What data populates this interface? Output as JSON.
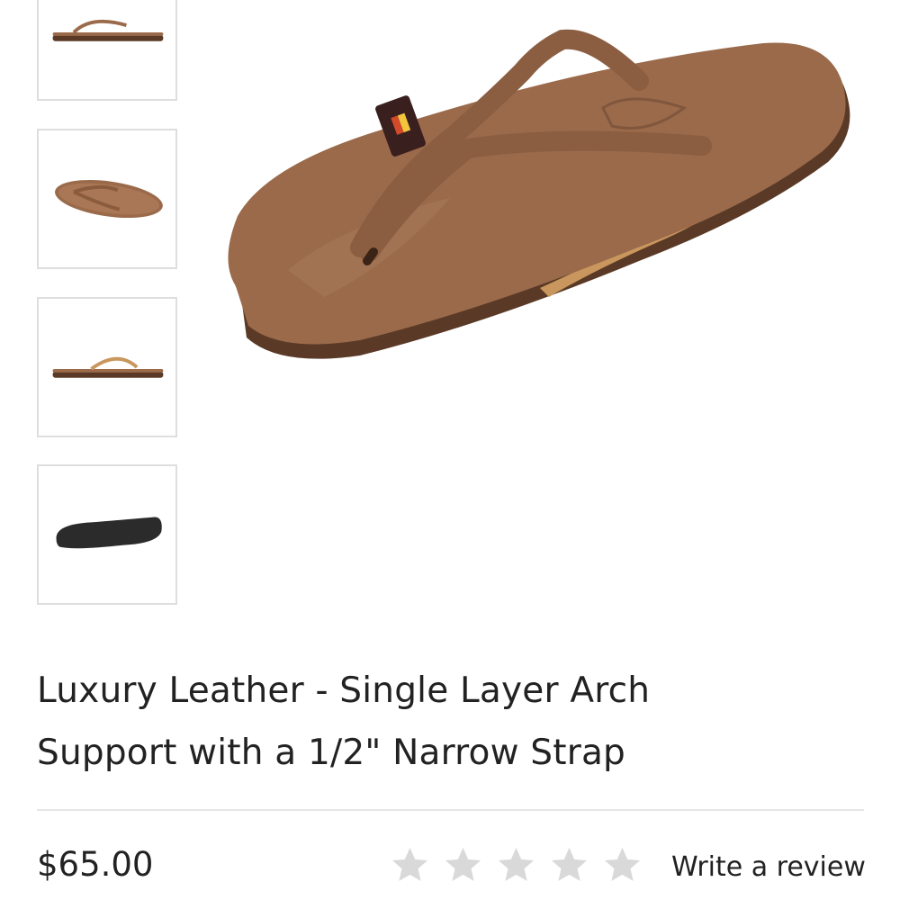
{
  "product": {
    "title_line1": "Luxury Leather - Single Layer Arch",
    "title_line2": "Support with a 1/2\" Narrow Strap",
    "price": "$65.00",
    "rating_stars": 0,
    "rating_max": 5,
    "write_review_label": "Write a review"
  },
  "thumbnails": [
    {
      "view": "side-view"
    },
    {
      "view": "top-view"
    },
    {
      "view": "side-view-alt"
    },
    {
      "view": "bottom-view"
    }
  ],
  "colors": {
    "leather": "#9a6a4b",
    "leather_dark": "#5a3a26",
    "arch": "#c9975d",
    "sole_bottom": "#2b2b2b",
    "star_empty": "#d9d9d9",
    "divider": "#e6e6e6",
    "text": "#222222"
  },
  "icons": {
    "rating": "star-icon",
    "strap_label": "RAINBOW"
  }
}
